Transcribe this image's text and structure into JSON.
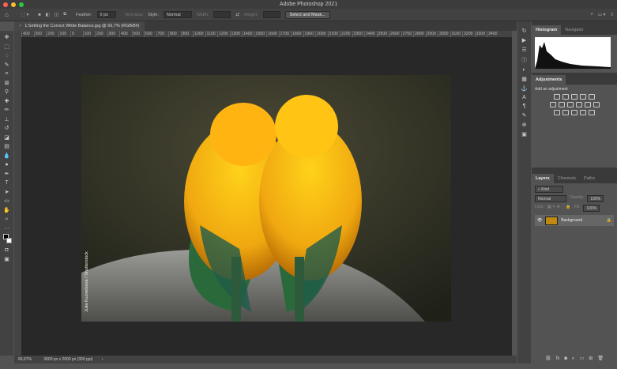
{
  "window": {
    "title": "Adobe Photoshop 2021"
  },
  "options": {
    "feather_label": "Feather:",
    "feather_value": "0 px",
    "anti_alias": "Anti-alias",
    "style_label": "Style:",
    "style_value": "Normal",
    "width_label": "Width:",
    "height_label": "Height:",
    "select_mask": "Select and Mask..."
  },
  "document": {
    "tab_title": "1:Setting the Correct White Balance.jpg @ 66,7% (RGB/8#)",
    "watermark": "Julia Kuznetsova / Shutterstock"
  },
  "ruler": [
    "400",
    "300",
    "200",
    "100",
    "0",
    "100",
    "200",
    "300",
    "400",
    "500",
    "600",
    "700",
    "800",
    "900",
    "1000",
    "1100",
    "1200",
    "1300",
    "1400",
    "1500",
    "1600",
    "1700",
    "1800",
    "1900",
    "2000",
    "2100",
    "2200",
    "2300",
    "2400",
    "2500",
    "2600",
    "2700",
    "2800",
    "2900",
    "3000",
    "3100",
    "3200",
    "3300",
    "3400"
  ],
  "status": {
    "zoom": "66,67%",
    "info": "3000 px x 2000 px (300 ppi)",
    "arrow": "›"
  },
  "panels": {
    "histogram_tab": "Histogram",
    "navigator_tab": "Navigator",
    "adjustments_tab": "Adjustments",
    "add_adjustment": "Add an adjustment",
    "layers_tab": "Layers",
    "channels_tab": "Channels",
    "paths_tab": "Paths",
    "kind": "Kind",
    "blend": "Normal",
    "opacity_label": "Opacity:",
    "opacity": "100%",
    "lock_label": "Lock:",
    "fill_label": "Fill:",
    "fill": "100%",
    "layer_name": "Background"
  }
}
